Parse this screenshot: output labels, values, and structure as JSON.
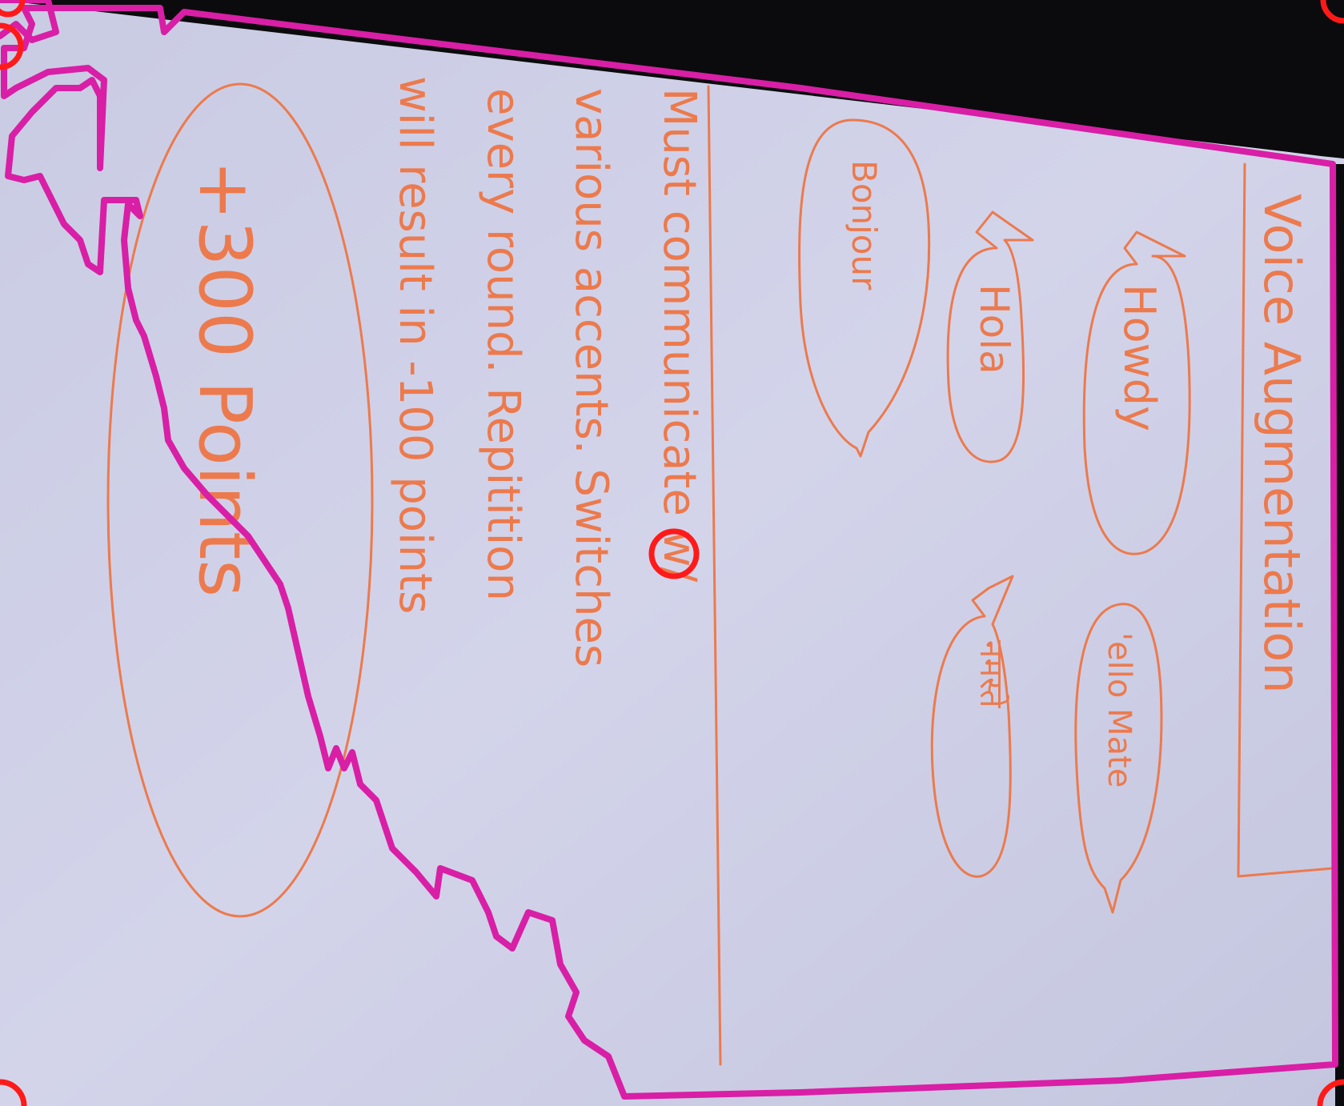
{
  "header": {
    "title": "Voice Augmentation"
  },
  "speech_bubbles": [
    {
      "id": "howdy",
      "text": "Howdy"
    },
    {
      "id": "ello-mate",
      "text": "'ello Mate"
    },
    {
      "id": "hola",
      "text": "Hola"
    },
    {
      "id": "hindi-text",
      "text": "नमस्ते"
    },
    {
      "id": "bonjour",
      "text": "Bonjour"
    }
  ],
  "instructions": {
    "lines": [
      "Must communicate w/",
      "various accents. Switches",
      "every round. Repitition",
      "will result in -100 points"
    ]
  },
  "reward": {
    "text": "+300 Points"
  },
  "colors": {
    "ink": "#ec7a4d",
    "paper": "#cfd0e6",
    "background": "#0b0b0d",
    "segmentation_outline": "#d81fa6",
    "marker": "#ff1a1a"
  }
}
